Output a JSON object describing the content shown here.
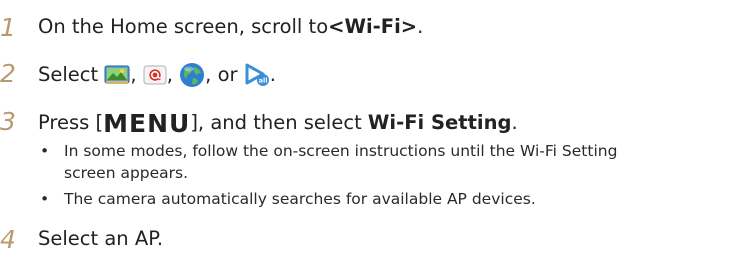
{
  "steps": [
    {
      "number": "1",
      "text_before": "On the Home screen, scroll to ",
      "bold": "<Wi-Fi>",
      "text_after": "."
    },
    {
      "number": "2",
      "text_before": "Select ",
      "sep1": ", ",
      "sep2": ", ",
      "sep3": ", or ",
      "text_after": ".",
      "icons": [
        "photo-share-icon",
        "email-icon",
        "globe-icon",
        "media-stream-icon"
      ]
    },
    {
      "number": "3",
      "text_before": "Press [",
      "key": "MENU",
      "text_mid": "], and then select ",
      "bold": "Wi-Fi Setting",
      "text_after": ".",
      "bullets": [
        {
          "marker": "•",
          "line1": "In some modes, follow the on-screen instructions until the Wi-Fi Setting",
          "line2": "screen appears."
        },
        {
          "marker": "•",
          "line1": "The camera automatically searches for available AP devices."
        }
      ]
    },
    {
      "number": "4",
      "text": "Select an AP."
    }
  ],
  "colors": {
    "step_number": "#b89a72",
    "body_text": "#222222"
  }
}
